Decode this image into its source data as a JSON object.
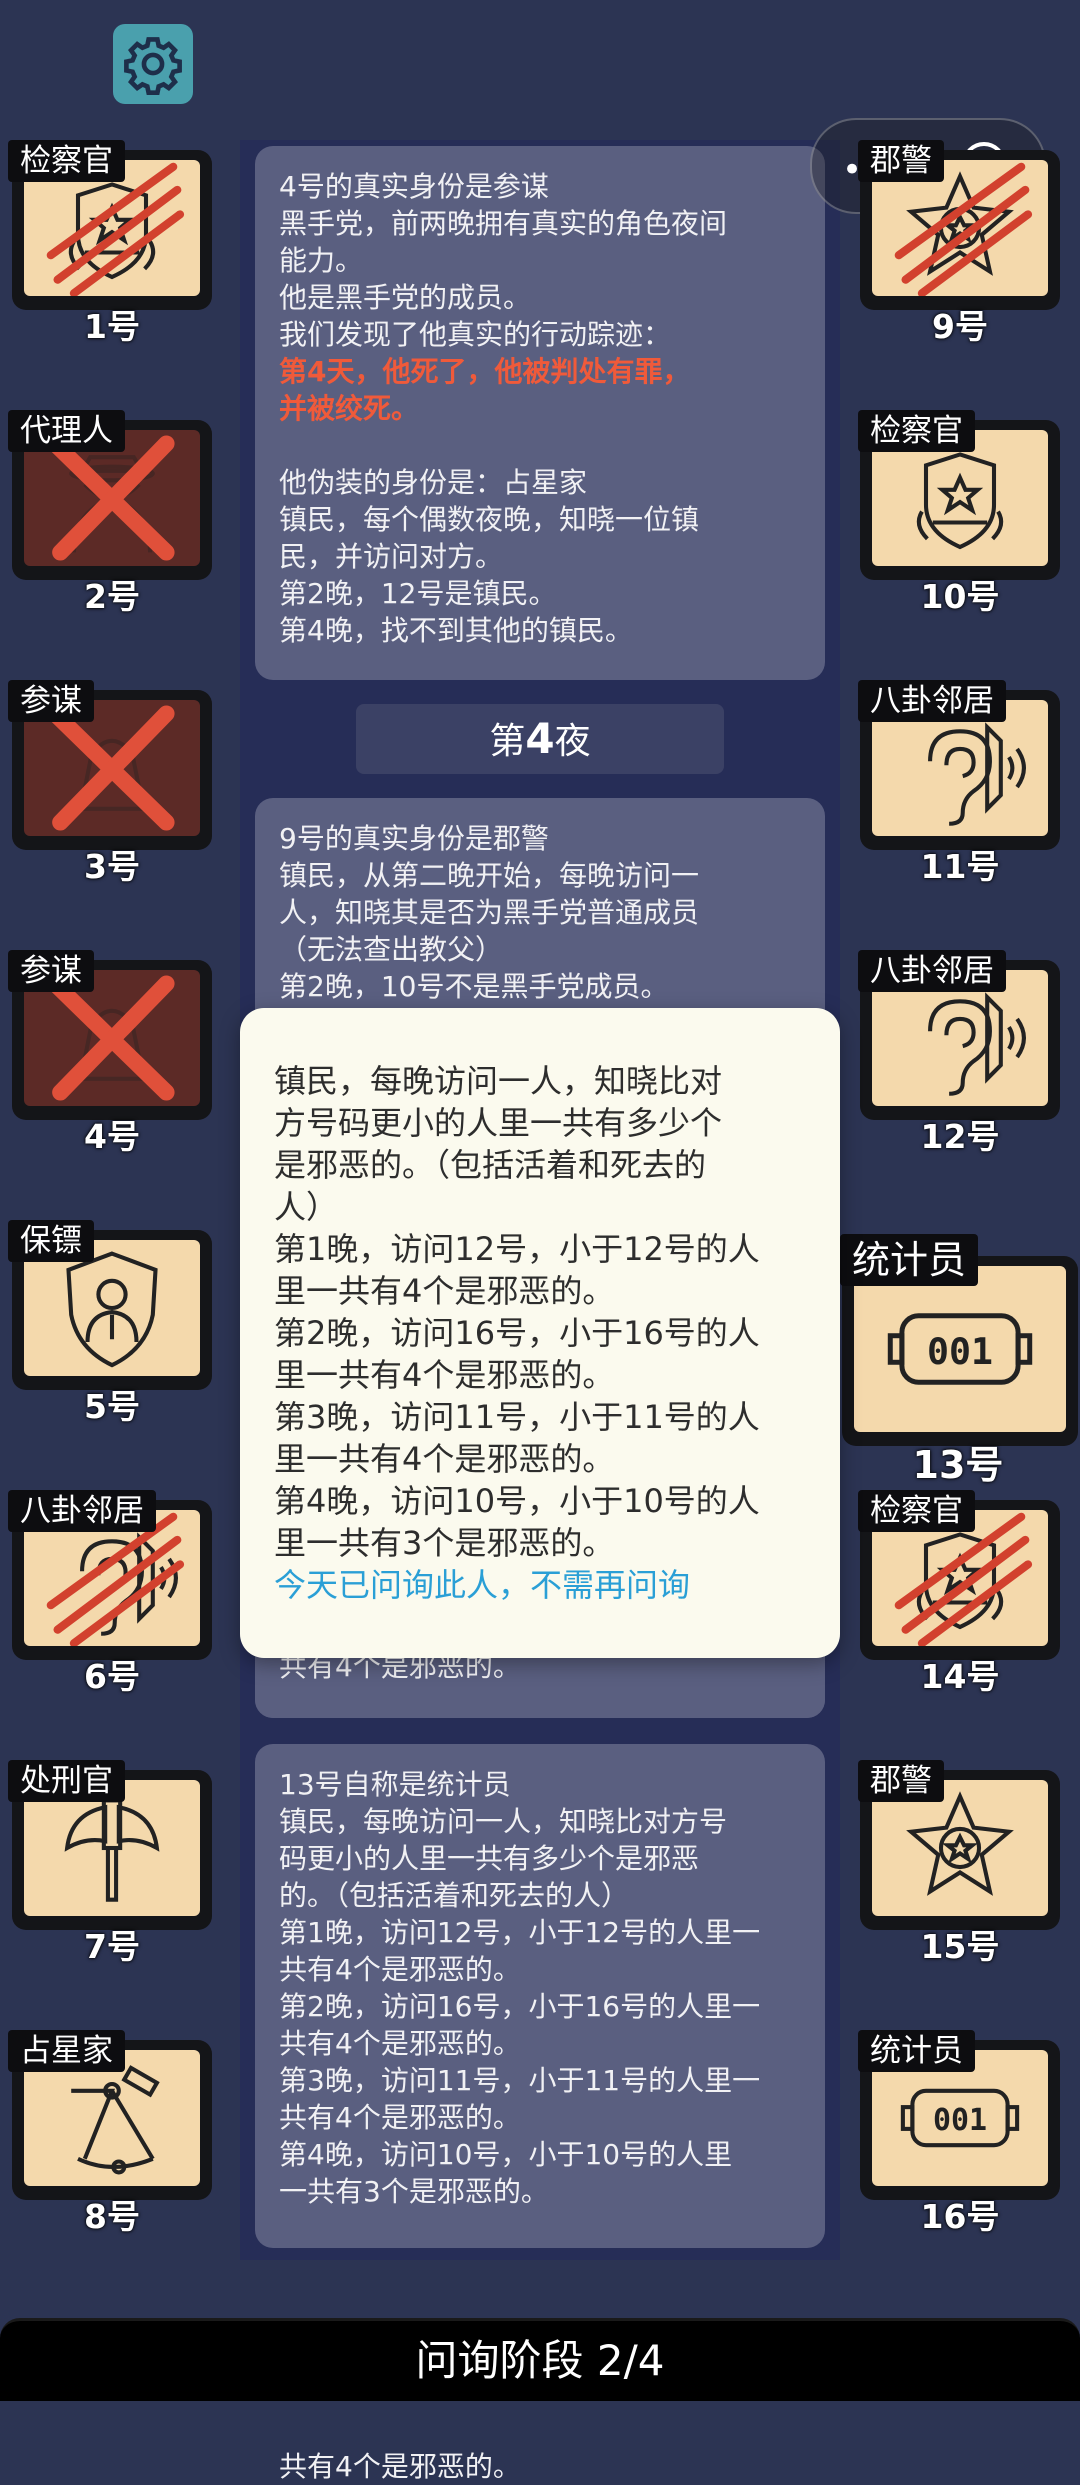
{
  "header": {
    "settings_icon": "gear-icon",
    "capsule": {
      "more_icon": "more-dots-icon",
      "close_icon": "target-icon"
    }
  },
  "left_players": [
    {
      "number": "1号",
      "role": "检察官",
      "state": "clawed",
      "icon": "prosecutor-icon"
    },
    {
      "number": "2号",
      "role": "代理人",
      "state": "crossed",
      "icon": "agent-icon"
    },
    {
      "number": "3号",
      "role": "参谋",
      "state": "crossed",
      "icon": "advisor-icon"
    },
    {
      "number": "4号",
      "role": "参谋",
      "state": "crossed",
      "icon": "advisor-icon"
    },
    {
      "number": "5号",
      "role": "保镖",
      "state": "alive",
      "icon": "bodyguard-icon"
    },
    {
      "number": "6号",
      "role": "八卦邻居",
      "state": "clawed",
      "icon": "ear-icon"
    },
    {
      "number": "7号",
      "role": "处刑官",
      "state": "alive",
      "icon": "axe-icon"
    },
    {
      "number": "8号",
      "role": "占星家",
      "state": "alive",
      "icon": "sextant-icon"
    }
  ],
  "right_players": [
    {
      "number": "9号",
      "role": "郡警",
      "state": "clawed",
      "icon": "sheriff-badge-icon"
    },
    {
      "number": "10号",
      "role": "检察官",
      "state": "alive",
      "icon": "prosecutor-icon"
    },
    {
      "number": "11号",
      "role": "八卦邻居",
      "state": "alive",
      "icon": "ear-icon"
    },
    {
      "number": "12号",
      "role": "八卦邻居",
      "state": "alive",
      "icon": "ear-icon"
    },
    {
      "number": "13号",
      "role": "统计员",
      "state": "selected",
      "icon": "counter-icon"
    },
    {
      "number": "14号",
      "role": "检察官",
      "state": "clawed",
      "icon": "prosecutor-icon"
    },
    {
      "number": "15号",
      "role": "郡警",
      "state": "alive",
      "icon": "sheriff-badge-icon"
    },
    {
      "number": "16号",
      "role": "统计员",
      "state": "alive",
      "icon": "counter-icon"
    }
  ],
  "counter_digits": "001",
  "log": {
    "msg1": {
      "lines": [
        "4号的真实身份是参谋",
        "黑手党，前两晚拥有真实的角色夜间",
        "能力。",
        "他是黑手党的成员。",
        "我们发现了他真实的行动踪迹："
      ],
      "red_lines": [
        "第4天，他死了，他被判处有罪，",
        "并被绞死。"
      ],
      "lines2": [
        "",
        "他伪装的身份是：占星家",
        "镇民，每个偶数夜晚，知晓一位镇",
        "民，并访问对方。",
        "第2晚，12号是镇民。",
        "第4晚，找不到其他的镇民。"
      ]
    },
    "night_prefix": "第",
    "night_num": "4",
    "night_suffix": "夜",
    "msg2": {
      "lines": [
        "9号的真实身份是郡警",
        "镇民，从第二晚开始，每晚访问一",
        "人，知晓其是否为黑手党普通成员",
        "（无法查出教父）",
        "第2晚，10号不是黑手党成员。"
      ],
      "tail": "共有4个是邪恶的。"
    },
    "msg3": {
      "lines": [
        "13号自称是统计员",
        "镇民，每晚访问一人，知晓比对方号",
        "码更小的人里一共有多少个是邪恶",
        "的。（包括活着和死去的人）",
        "第1晚，访问12号，小于12号的人里一",
        "共有4个是邪恶的。",
        "第2晚，访问16号，小于16号的人里一",
        "共有4个是邪恶的。",
        "第3晚，访问11号，小于11号的人里一",
        "共有4个是邪恶的。",
        "第4晚，访问10号，小于10号的人里",
        "一共有3个是邪恶的。"
      ]
    }
  },
  "popup": {
    "lines": [
      "镇民，每晚访问一人，知晓比对",
      "方号码更小的人里一共有多少个",
      "是邪恶的。（包括活着和死去的",
      "人）",
      "第1晚，访问12号，小于12号的人",
      "里一共有4个是邪恶的。",
      "第2晚，访问16号，小于16号的人",
      "里一共有4个是邪恶的。",
      "第3晚，访问11号，小于11号的人",
      "里一共有4个是邪恶的。",
      "第4晚，访问10号，小于10号的人",
      "里一共有3个是邪恶的。"
    ],
    "notice": "今天已问询此人，不需再问询"
  },
  "footer": {
    "phase": "问询阶段 2/4"
  },
  "colors": {
    "background": "#2c3453",
    "card": "#f4d9ac",
    "dead_card": "#5c2a26",
    "cross": "#e0503a",
    "notice": "#2a9fd6",
    "highlight": "#f05a3a"
  }
}
